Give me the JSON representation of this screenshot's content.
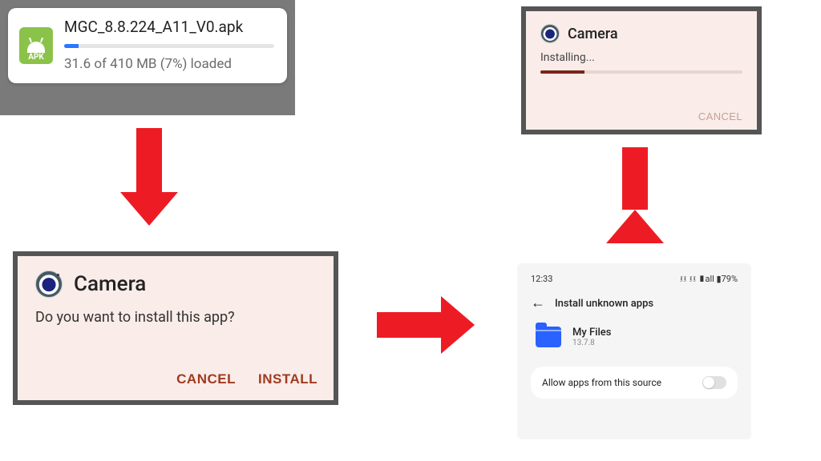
{
  "download": {
    "icon_label": "APK",
    "filename": "MGC_8.8.224_A11_V0.apk",
    "progress_text": "31.6 of 410 MB (7%) loaded",
    "progress_percent": 7
  },
  "prompt": {
    "app_name": "Camera",
    "message": "Do you want to install this app?",
    "cancel": "CANCEL",
    "install": "INSTALL"
  },
  "installing": {
    "app_name": "Camera",
    "status": "Installing...",
    "cancel": "CANCEL",
    "progress_percent": 22
  },
  "settings": {
    "statusbar": {
      "time": "12:33",
      "right": "፤፤ ፤፤ ▮all ▮79%"
    },
    "title": "Install unknown apps",
    "app_name": "My Files",
    "app_version": "13.7.8",
    "allow_label": "Allow apps from this source",
    "allow_enabled": false
  }
}
